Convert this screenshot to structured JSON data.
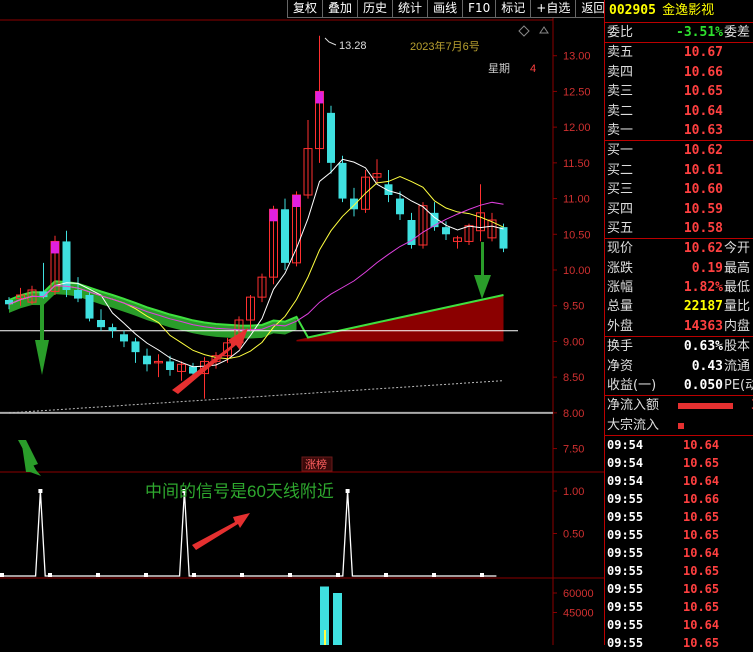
{
  "toolbar": [
    "复权",
    "叠加",
    "历史",
    "统计",
    "画线",
    "F10",
    "标记",
    "+自选",
    "返回"
  ],
  "chart_header": {
    "date": "2023年7月6号",
    "weekday_label": "星期",
    "weekday_value": "4",
    "high_label": "13.28"
  },
  "badge": "涨榜",
  "annotation": "中间的信号是60天线附近",
  "chart_data": [
    {
      "type": "candlestick",
      "ylim": [
        7.2,
        13.5
      ],
      "yticks": [
        "13.00",
        "12.50",
        "12.00",
        "11.50",
        "11.00",
        "10.50",
        "10.00",
        "9.50",
        "9.00",
        "8.50",
        "8.00",
        "7.50"
      ],
      "candles": [
        {
          "o": 9.58,
          "h": 9.62,
          "l": 9.45,
          "c": 9.52
        },
        {
          "o": 9.6,
          "h": 9.75,
          "l": 9.5,
          "c": 9.65
        },
        {
          "o": 9.55,
          "h": 9.78,
          "l": 9.52,
          "c": 9.72
        },
        {
          "o": 9.7,
          "h": 10.1,
          "l": 9.6,
          "c": 9.62
        },
        {
          "o": 9.7,
          "h": 10.48,
          "l": 9.65,
          "c": 10.4
        },
        {
          "o": 10.4,
          "h": 10.55,
          "l": 9.62,
          "c": 9.72
        },
        {
          "o": 9.72,
          "h": 9.9,
          "l": 9.55,
          "c": 9.6
        },
        {
          "o": 9.65,
          "h": 9.7,
          "l": 9.28,
          "c": 9.32
        },
        {
          "o": 9.3,
          "h": 9.45,
          "l": 9.15,
          "c": 9.2
        },
        {
          "o": 9.2,
          "h": 9.25,
          "l": 9.05,
          "c": 9.15
        },
        {
          "o": 9.1,
          "h": 9.15,
          "l": 8.92,
          "c": 9.0
        },
        {
          "o": 9.0,
          "h": 9.05,
          "l": 8.7,
          "c": 8.85
        },
        {
          "o": 8.8,
          "h": 8.9,
          "l": 8.58,
          "c": 8.68
        },
        {
          "o": 8.7,
          "h": 8.82,
          "l": 8.5,
          "c": 8.72
        },
        {
          "o": 8.72,
          "h": 8.8,
          "l": 8.52,
          "c": 8.6
        },
        {
          "o": 8.58,
          "h": 8.72,
          "l": 8.45,
          "c": 8.68
        },
        {
          "o": 8.65,
          "h": 8.7,
          "l": 8.48,
          "c": 8.55
        },
        {
          "o": 8.55,
          "h": 8.78,
          "l": 8.2,
          "c": 8.72
        },
        {
          "o": 8.72,
          "h": 8.85,
          "l": 8.62,
          "c": 8.8
        },
        {
          "o": 8.8,
          "h": 9.05,
          "l": 8.7,
          "c": 8.98
        },
        {
          "o": 8.98,
          "h": 9.35,
          "l": 8.9,
          "c": 9.3
        },
        {
          "o": 9.3,
          "h": 9.65,
          "l": 9.15,
          "c": 9.62
        },
        {
          "o": 9.62,
          "h": 9.95,
          "l": 9.55,
          "c": 9.9
        },
        {
          "o": 9.9,
          "h": 10.9,
          "l": 9.8,
          "c": 10.85
        },
        {
          "o": 10.85,
          "h": 11.0,
          "l": 10.0,
          "c": 10.1
        },
        {
          "o": 10.1,
          "h": 11.1,
          "l": 10.05,
          "c": 11.05
        },
        {
          "o": 11.05,
          "h": 12.1,
          "l": 11.0,
          "c": 11.7
        },
        {
          "o": 11.7,
          "h": 13.28,
          "l": 11.5,
          "c": 12.5
        },
        {
          "o": 12.2,
          "h": 12.3,
          "l": 11.35,
          "c": 11.5
        },
        {
          "o": 11.5,
          "h": 11.6,
          "l": 10.95,
          "c": 11.0
        },
        {
          "o": 11.0,
          "h": 11.15,
          "l": 10.75,
          "c": 10.85
        },
        {
          "o": 10.85,
          "h": 11.4,
          "l": 10.8,
          "c": 11.3
        },
        {
          "o": 11.3,
          "h": 11.55,
          "l": 11.2,
          "c": 11.35
        },
        {
          "o": 11.2,
          "h": 11.4,
          "l": 10.95,
          "c": 11.05
        },
        {
          "o": 11.0,
          "h": 11.1,
          "l": 10.7,
          "c": 10.78
        },
        {
          "o": 10.7,
          "h": 10.8,
          "l": 10.3,
          "c": 10.35
        },
        {
          "o": 10.35,
          "h": 10.95,
          "l": 10.3,
          "c": 10.9
        },
        {
          "o": 10.8,
          "h": 10.95,
          "l": 10.55,
          "c": 10.6
        },
        {
          "o": 10.6,
          "h": 10.68,
          "l": 10.42,
          "c": 10.5
        },
        {
          "o": 10.4,
          "h": 10.48,
          "l": 10.3,
          "c": 10.45
        },
        {
          "o": 10.4,
          "h": 10.65,
          "l": 10.35,
          "c": 10.62
        },
        {
          "o": 10.55,
          "h": 11.2,
          "l": 10.4,
          "c": 10.8
        },
        {
          "o": 10.45,
          "h": 10.8,
          "l": 10.4,
          "c": 10.7
        },
        {
          "o": 10.6,
          "h": 10.65,
          "l": 10.25,
          "c": 10.3
        }
      ]
    },
    {
      "type": "line",
      "ylim": [
        0,
        1.2
      ],
      "yticks": [
        "1.00",
        "0.50"
      ],
      "values": [
        0,
        0,
        0,
        0,
        0,
        0,
        0,
        0,
        1,
        0,
        0,
        0,
        0,
        0,
        0,
        0,
        0,
        0,
        0,
        0,
        0,
        0,
        0,
        0,
        0,
        0,
        0,
        0,
        0,
        0,
        0,
        0,
        0,
        0,
        0,
        0,
        0,
        0,
        1,
        0,
        0,
        0,
        0,
        0,
        0,
        0,
        0,
        0,
        0,
        0,
        0,
        0,
        0,
        0,
        0,
        0,
        0,
        0,
        0,
        0,
        0,
        0,
        0,
        0,
        0,
        0,
        0,
        0,
        0,
        0,
        0,
        0,
        1,
        0,
        0,
        0,
        0,
        0,
        0,
        0,
        0,
        0,
        0,
        0,
        0,
        0,
        0,
        0,
        0,
        0,
        0,
        0,
        0,
        0,
        0,
        0,
        0,
        0,
        0,
        0,
        0,
        0,
        0,
        0
      ]
    },
    {
      "type": "bar",
      "ylim": [
        20000,
        70000
      ],
      "yticks": [
        "60000",
        "45000"
      ],
      "values": [
        65000,
        60000
      ]
    }
  ],
  "quote": {
    "code": "002905",
    "name": "金逸影视",
    "weibi_label": "委比",
    "weibi_value": "-3.51%",
    "weicha_label": "委差",
    "asks": [
      {
        "label": "卖五",
        "price": "10.67"
      },
      {
        "label": "卖四",
        "price": "10.66"
      },
      {
        "label": "卖三",
        "price": "10.65"
      },
      {
        "label": "卖二",
        "price": "10.64"
      },
      {
        "label": "卖一",
        "price": "10.63"
      }
    ],
    "bids": [
      {
        "label": "买一",
        "price": "10.62"
      },
      {
        "label": "买二",
        "price": "10.61"
      },
      {
        "label": "买三",
        "price": "10.60"
      },
      {
        "label": "买四",
        "price": "10.59"
      },
      {
        "label": "买五",
        "price": "10.58"
      }
    ],
    "stats": [
      {
        "label": "现价",
        "value": "10.62",
        "ext": "今开",
        "color": "red"
      },
      {
        "label": "涨跌",
        "value": "0.19",
        "ext": "最高",
        "color": "red"
      },
      {
        "label": "涨幅",
        "value": "1.82%",
        "ext": "最低",
        "color": "red"
      },
      {
        "label": "总量",
        "value": "22187",
        "ext": "量比",
        "color": "yellow"
      },
      {
        "label": "外盘",
        "value": "14363",
        "ext": "内盘",
        "color": "red"
      }
    ],
    "stats2": [
      {
        "label": "换手",
        "value": "0.63%",
        "ext": "股本"
      },
      {
        "label": "净资",
        "value": "0.43",
        "ext": "流通"
      },
      {
        "label": "收益(一)",
        "value": "0.050",
        "ext": "PE(动"
      }
    ],
    "flow_label": "净流入额",
    "flow_value": "3",
    "bigorder_label": "大宗流入",
    "ticks": [
      {
        "t": "09:54",
        "p": "10.64"
      },
      {
        "t": "09:54",
        "p": "10.65"
      },
      {
        "t": "09:54",
        "p": "10.64"
      },
      {
        "t": "09:55",
        "p": "10.66"
      },
      {
        "t": "09:55",
        "p": "10.65"
      },
      {
        "t": "09:55",
        "p": "10.65"
      },
      {
        "t": "09:55",
        "p": "10.64"
      },
      {
        "t": "09:55",
        "p": "10.65"
      },
      {
        "t": "09:55",
        "p": "10.65"
      },
      {
        "t": "09:55",
        "p": "10.65"
      },
      {
        "t": "09:55",
        "p": "10.64"
      },
      {
        "t": "09:55",
        "p": "10.65"
      }
    ]
  }
}
